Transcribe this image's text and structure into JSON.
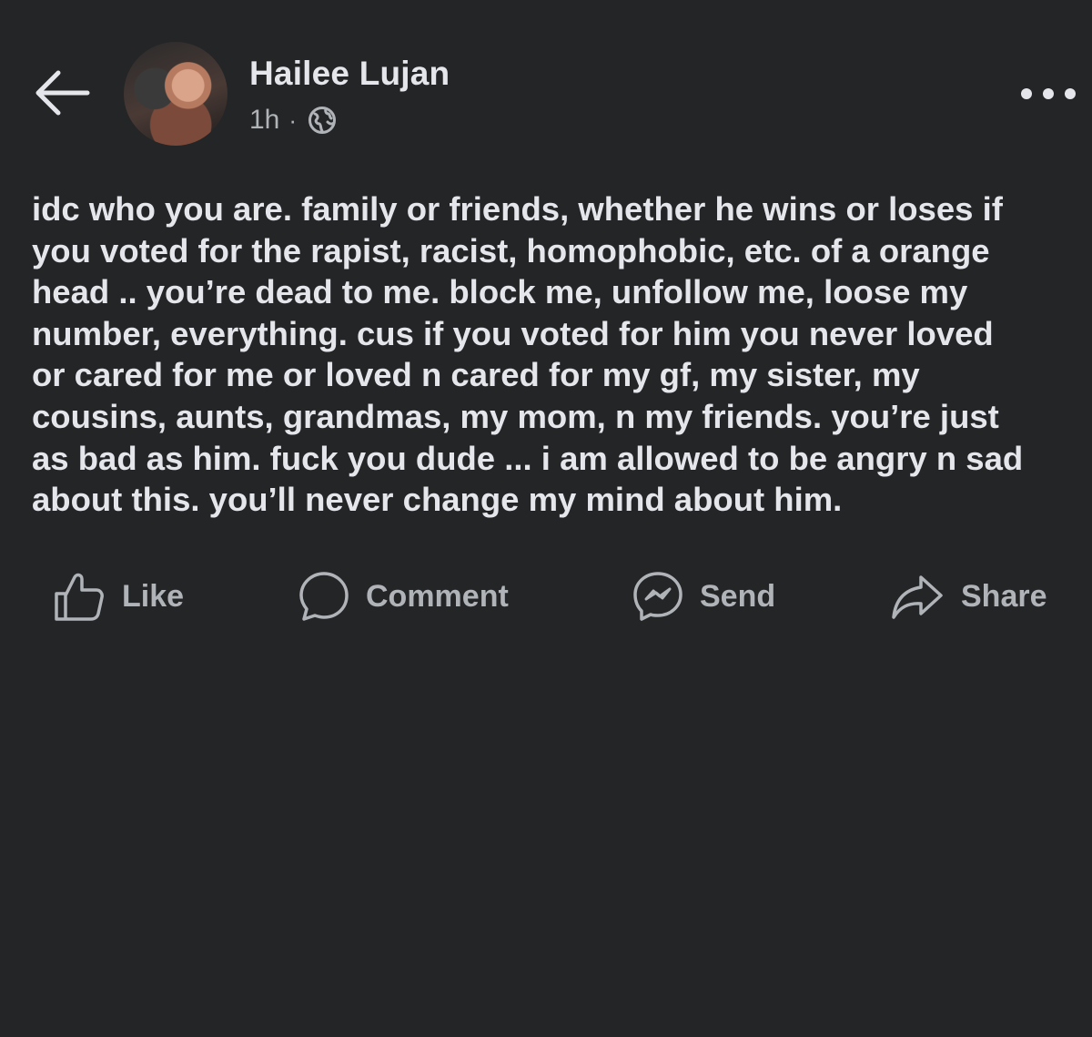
{
  "post": {
    "author": "Hailee Lujan",
    "time": "1h",
    "separator": "·",
    "audience_icon": "globe-icon",
    "body": "idc who you are. family or friends, whether he wins or loses if\nyou voted for the rapist, racist, homophobic, etc. of a orange\nhead .. you’re dead to me. block me, unfollow me, loose my\nnumber, everything. cus if you voted for him you never loved\nor cared for me or loved n cared for my gf, my sister, my\ncousins, aunts, grandmas, my mom, n my friends. you’re just\nas bad as him. fuck you dude ... i am allowed to be angry n sad\nabout this. you’ll never change my mind about him."
  },
  "actions": {
    "like": "Like",
    "comment": "Comment",
    "send": "Send",
    "share": "Share"
  },
  "colors": {
    "background": "#242526",
    "text_primary": "#e4e6eb",
    "text_secondary": "#b0b3b8"
  }
}
